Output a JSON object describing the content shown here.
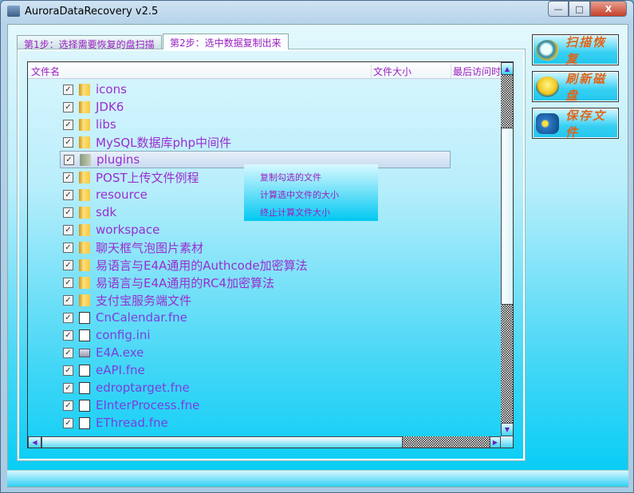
{
  "window": {
    "title": "AuroraDataRecovery v2.5",
    "minimize": "—",
    "maximize": "□",
    "close": "X"
  },
  "tabs": [
    {
      "label": "第1步：选择需要恢复的盘扫描"
    },
    {
      "label": "第2步：选中数据复制出来"
    }
  ],
  "columns": [
    "文件名",
    "文件大小",
    "最后访问时"
  ],
  "rows": [
    {
      "name": "icons",
      "type": "folder"
    },
    {
      "name": "JDK6",
      "type": "folder"
    },
    {
      "name": "libs",
      "type": "folder"
    },
    {
      "name": "MySQL数据库php中间件",
      "type": "folder"
    },
    {
      "name": "plugins",
      "type": "folder-selected"
    },
    {
      "name": "POST上传文件例程",
      "type": "folder"
    },
    {
      "name": "resource",
      "type": "folder"
    },
    {
      "name": "sdk",
      "type": "folder"
    },
    {
      "name": "workspace",
      "type": "folder"
    },
    {
      "name": "聊天框气泡图片素材",
      "type": "folder"
    },
    {
      "name": "易语言与E4A通用的Authcode加密算法",
      "type": "folder"
    },
    {
      "name": "易语言与E4A通用的RC4加密算法",
      "type": "folder"
    },
    {
      "name": "支付宝服务端文件",
      "type": "folder"
    },
    {
      "name": "CnCalendar.fne",
      "type": "file"
    },
    {
      "name": "config.ini",
      "type": "file"
    },
    {
      "name": "E4A.exe",
      "type": "exe"
    },
    {
      "name": "eAPI.fne",
      "type": "file"
    },
    {
      "name": "edroptarget.fne",
      "type": "file"
    },
    {
      "name": "EInterProcess.fne",
      "type": "file"
    },
    {
      "name": "EThread.fne",
      "type": "file"
    }
  ],
  "checkmark": "✓",
  "buttons": {
    "scan": "扫描恢复",
    "refresh": "刷新磁盘",
    "save": "保存文件"
  },
  "context_menu": [
    "复制勾选的文件",
    "计算选中文件的大小",
    "终止计算文件大小"
  ],
  "scroll": {
    "up": "▲",
    "down": "▼",
    "left": "◀",
    "right": "▶"
  }
}
